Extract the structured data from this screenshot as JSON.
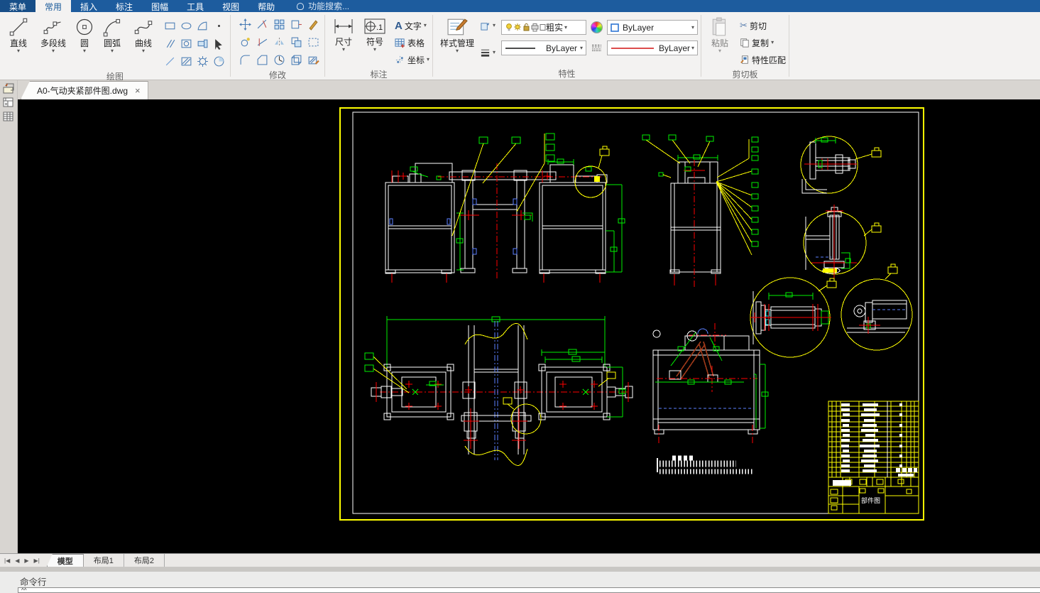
{
  "menu": {
    "items": [
      "菜单",
      "常用",
      "插入",
      "标注",
      "图幅",
      "工具",
      "视图",
      "帮助"
    ],
    "search_placeholder": "功能搜索..."
  },
  "ribbon": {
    "draw": {
      "label": "绘图",
      "buttons": [
        "直线",
        "多段线",
        "圆",
        "圆弧",
        "曲线"
      ]
    },
    "modify": {
      "label": "修改"
    },
    "annotate": {
      "label": "标注",
      "dimension": "尺寸",
      "symbol": "符号",
      "text": "文字",
      "table": "表格",
      "coordinate": "坐标"
    },
    "properties": {
      "label": "特性",
      "style_manager": "样式管理",
      "layer_name": "粗实线",
      "color_value": "ByLayer",
      "lineweight_value": "ByLayer",
      "linetype_value": "ByLayer"
    },
    "clipboard": {
      "label": "剪切板",
      "paste": "粘贴",
      "cut": "剪切",
      "copy": "复制",
      "match": "特性匹配"
    }
  },
  "document": {
    "tab_title": "A0-气动夹紧部件图.dwg",
    "close_glyph": "×"
  },
  "canvas": {
    "title_block_text": "部件图"
  },
  "statusbar": {
    "tabs": [
      "模型",
      "布局1",
      "布局2"
    ]
  },
  "command": {
    "label": "命令行",
    "prompt": "^^"
  },
  "icons": {
    "dropdown": "▾",
    "cut_glyph": "✂",
    "text_tool": "A",
    "symbol_suffix": ".1",
    "nav_first": "|◀",
    "nav_prev": "◀",
    "nav_next": "▶",
    "nav_last": "▶|"
  },
  "colors": {
    "menubar": "#1d5c9e",
    "canvas_bg": "#000000",
    "cad_yellow": "#ffff00",
    "cad_green": "#00ef00",
    "cad_red": "#ff0000",
    "cad_white": "#ffffff",
    "cad_blue": "#5b7fff",
    "cad_maroon": "#a03a1a"
  }
}
